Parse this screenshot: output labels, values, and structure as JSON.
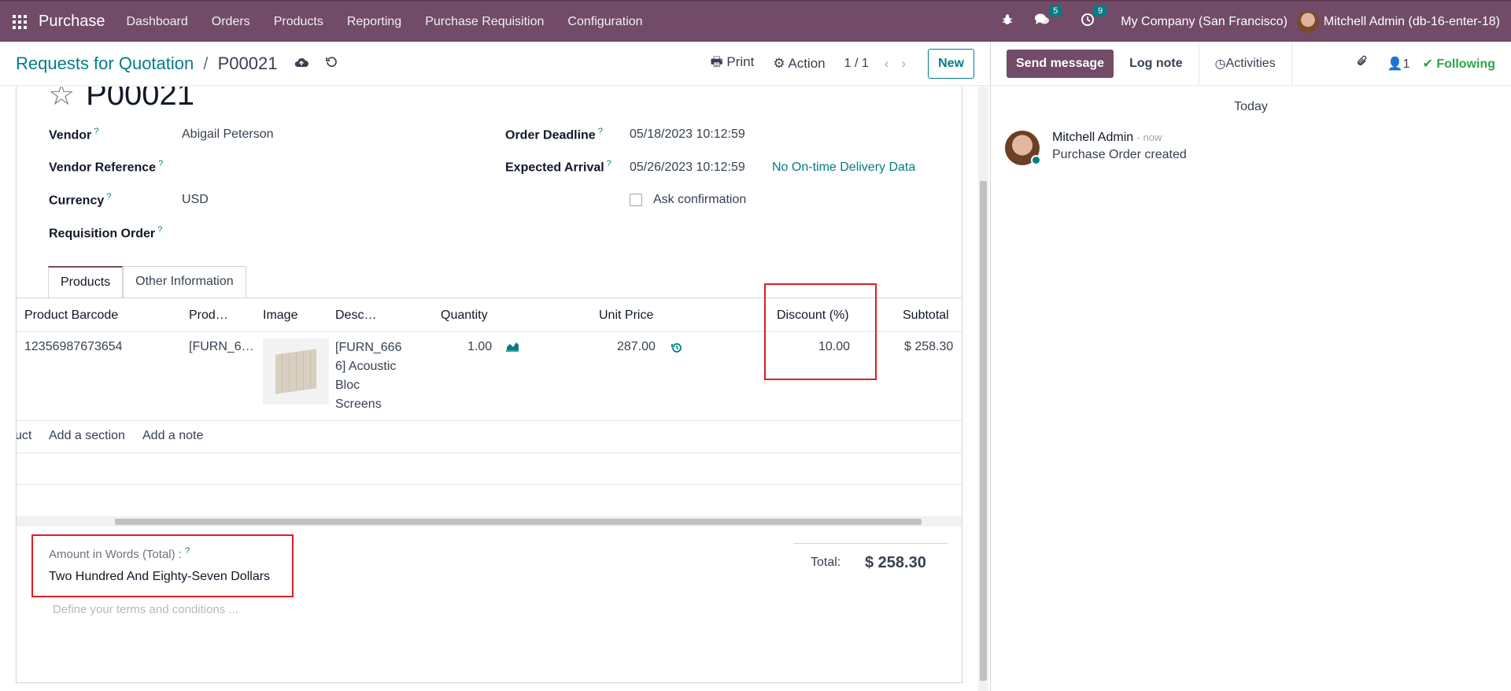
{
  "topbar": {
    "app_name": "Purchase",
    "nav": [
      "Dashboard",
      "Orders",
      "Products",
      "Reporting",
      "Purchase Requisition",
      "Configuration"
    ],
    "messages_count": "5",
    "activities_count": "9",
    "company": "My Company (San Francisco)",
    "user": "Mitchell Admin (db-16-enter-18)"
  },
  "control": {
    "breadcrumb_parent": "Requests for Quotation",
    "breadcrumb_sep": "/",
    "breadcrumb_current": "P00021",
    "print": "Print",
    "action": "Action",
    "pager": "1 / 1",
    "new": "New"
  },
  "form": {
    "title": "P00021",
    "vendor_label": "Vendor",
    "vendor": "Abigail Peterson",
    "vendor_ref_label": "Vendor Reference",
    "currency_label": "Currency",
    "currency": "USD",
    "requisition_label": "Requisition Order",
    "order_deadline_label": "Order Deadline",
    "order_deadline": "05/18/2023 10:12:59",
    "expected_arrival_label": "Expected Arrival",
    "expected_arrival": "05/26/2023 10:12:59",
    "ontime_link": "No On-time Delivery Data",
    "ask_confirmation": "Ask confirmation",
    "help_mark": "?"
  },
  "tabs": [
    "Products",
    "Other Information"
  ],
  "table": {
    "headers": [
      "Product Barcode",
      "Prod…",
      "Image",
      "Desc…",
      "Quantity",
      "Unit Price",
      "Discount (%)",
      "Subtotal"
    ],
    "row": {
      "barcode": "12356987673654",
      "product": "[FURN_6…",
      "description": [
        "[FURN_666",
        "6] Acoustic",
        "Bloc",
        "Screens"
      ],
      "quantity": "1.00",
      "unit_price": "287.00",
      "discount": "10.00",
      "subtotal": "$ 258.30"
    },
    "add_product": "uct",
    "add_section": "Add a section",
    "add_note": "Add a note"
  },
  "footer": {
    "amount_words_label": "Amount in Words (Total) :",
    "amount_words": "Two Hundred And Eighty-Seven Dollars",
    "terms_placeholder": "Define your terms and conditions ...",
    "total_label": "Total:",
    "total_value": "$ 258.30"
  },
  "chatter": {
    "send_message": "Send message",
    "log_note": "Log note",
    "activities": "Activities",
    "followers_count": "1",
    "following": "Following",
    "today": "Today",
    "message": {
      "author": "Mitchell Admin",
      "time": "- now",
      "text": "Purchase Order created"
    }
  },
  "colors": {
    "brand": "#714B67",
    "link": "#017e84",
    "highlight_box": "#e11d23",
    "following": "#28a745"
  }
}
